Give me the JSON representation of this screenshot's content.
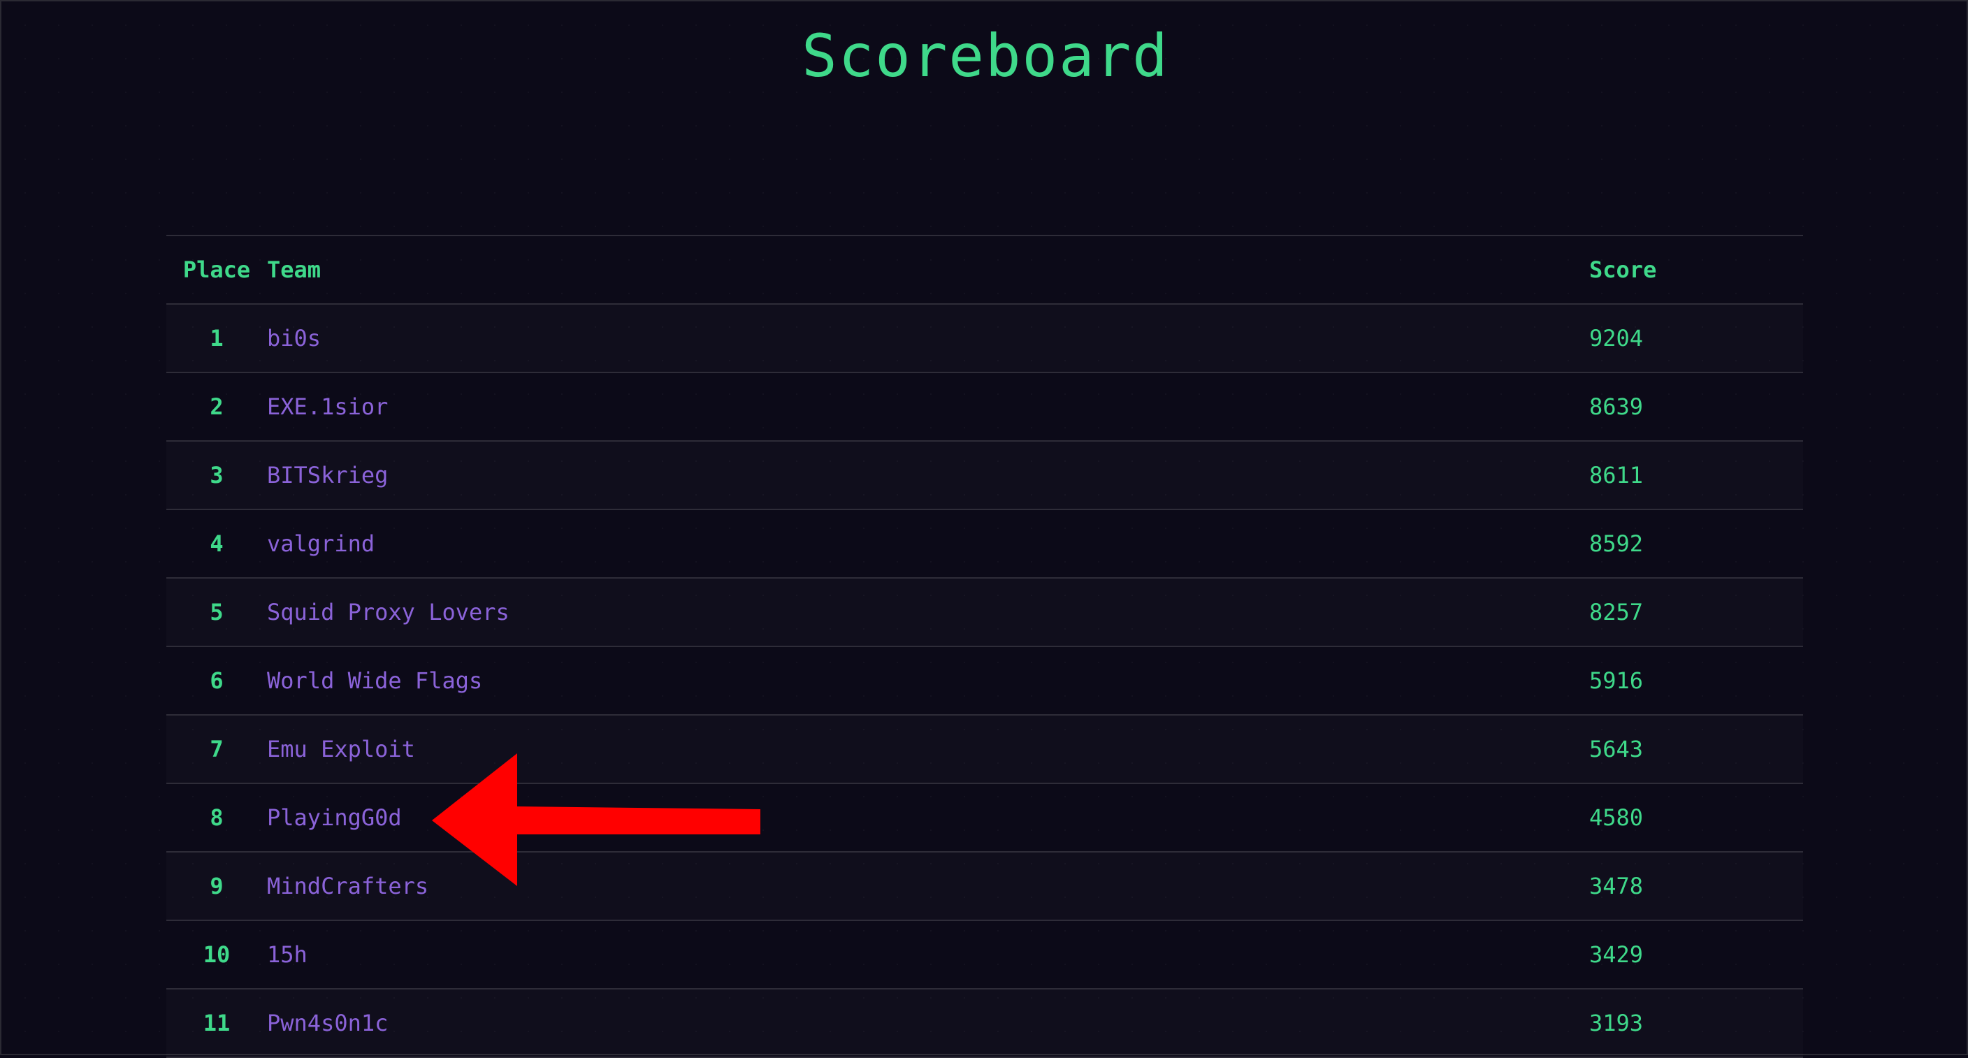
{
  "page": {
    "title": "Scoreboard"
  },
  "table": {
    "headers": {
      "place": "Place",
      "team": "Team",
      "score": "Score"
    },
    "rows": [
      {
        "place": "1",
        "team": "bi0s",
        "score": "9204"
      },
      {
        "place": "2",
        "team": "EXE.1sior",
        "score": "8639"
      },
      {
        "place": "3",
        "team": "BITSkrieg",
        "score": "8611"
      },
      {
        "place": "4",
        "team": "valgrind",
        "score": "8592"
      },
      {
        "place": "5",
        "team": "Squid Proxy Lovers",
        "score": "8257"
      },
      {
        "place": "6",
        "team": "World Wide Flags",
        "score": "5916"
      },
      {
        "place": "7",
        "team": "Emu Exploit",
        "score": "5643"
      },
      {
        "place": "8",
        "team": "PlayingG0d",
        "score": "4580"
      },
      {
        "place": "9",
        "team": "MindCrafters",
        "score": "3478"
      },
      {
        "place": "10",
        "team": "15h",
        "score": "3429"
      },
      {
        "place": "11",
        "team": "Pwn4s0n1c",
        "score": "3193"
      }
    ]
  },
  "annotation": {
    "icon": "red-arrow-left-icon",
    "color": "#ff0000",
    "points_to_place": "8"
  },
  "colors": {
    "background": "#0c0a18",
    "accent_green": "#3fd98a",
    "team_purple": "#8b63d9",
    "divider": "#2e2c38"
  }
}
